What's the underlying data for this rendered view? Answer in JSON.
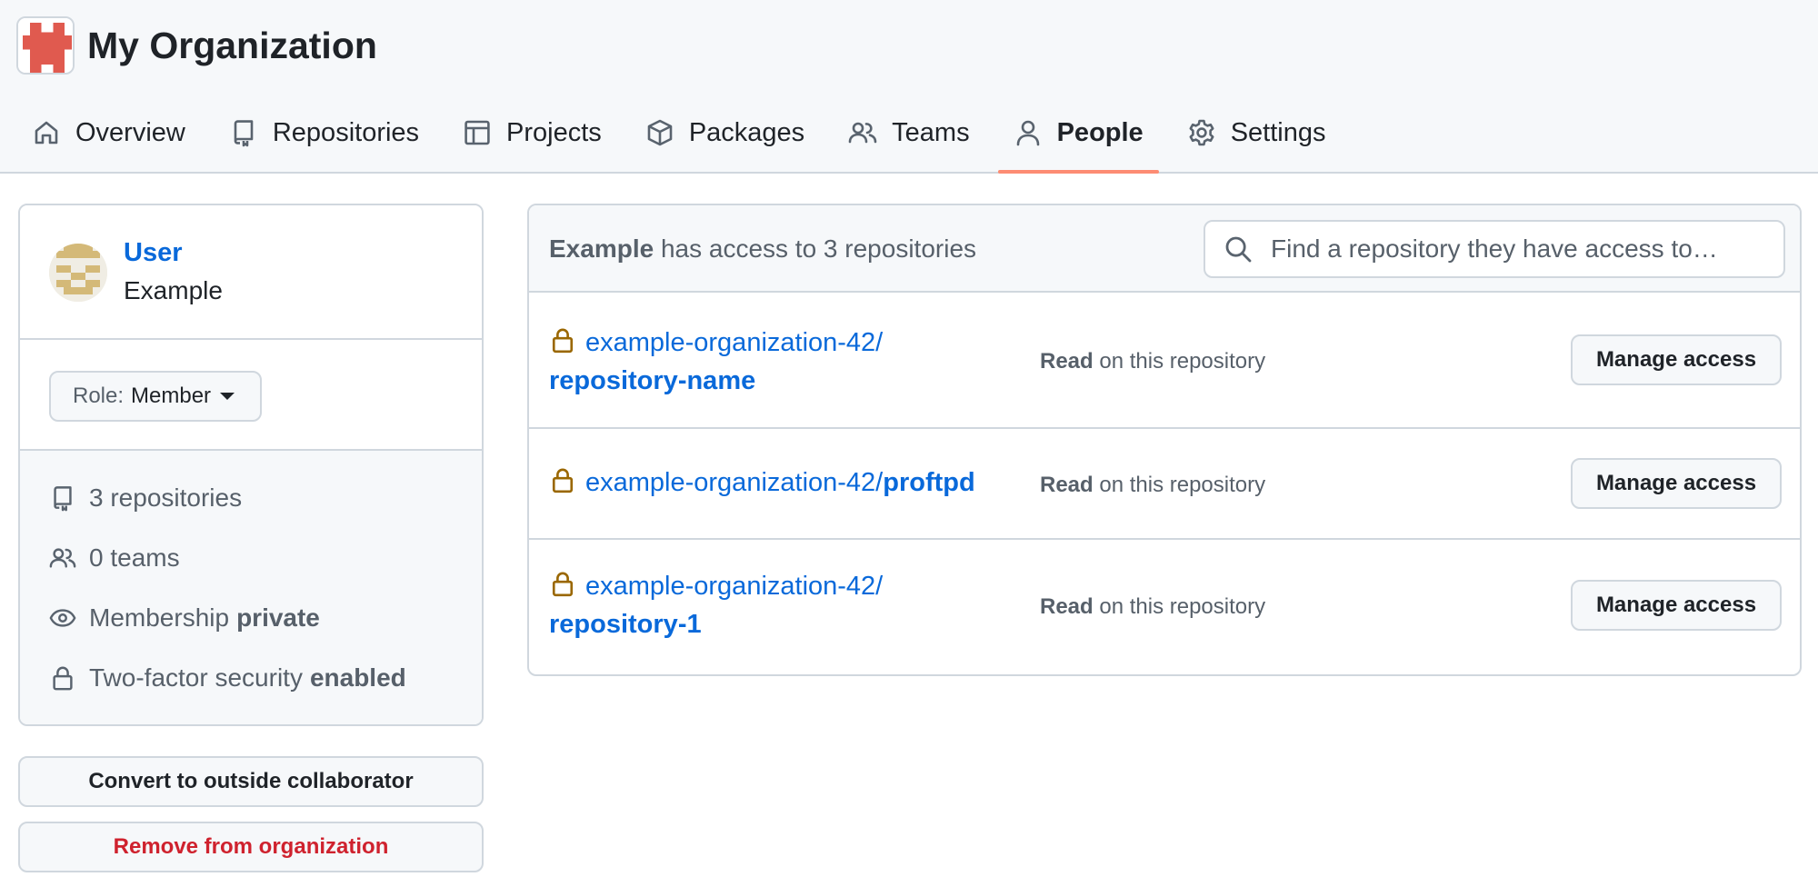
{
  "org": {
    "name": "My Organization",
    "avatar_icon": "org-logo-identicon",
    "avatar_color": "#e05a4f"
  },
  "tabs": [
    {
      "label": "Overview",
      "icon": "home-icon",
      "active": false
    },
    {
      "label": "Repositories",
      "icon": "repo-icon",
      "active": false
    },
    {
      "label": "Projects",
      "icon": "table-icon",
      "active": false
    },
    {
      "label": "Packages",
      "icon": "package-icon",
      "active": false
    },
    {
      "label": "Teams",
      "icon": "people-icon",
      "active": false
    },
    {
      "label": "People",
      "icon": "person-icon",
      "active": true
    },
    {
      "label": "Settings",
      "icon": "gear-icon",
      "active": false
    }
  ],
  "user": {
    "login": "User",
    "full_name": "Example",
    "role_prefix": "Role:",
    "role": "Member",
    "stats": {
      "repos": "3 repositories",
      "teams": "0 teams",
      "membership_prefix": "Membership",
      "membership_value": "private",
      "twofa_prefix": "Two-factor security",
      "twofa_value": "enabled"
    },
    "convert_label": "Convert to outside collaborator",
    "remove_label": "Remove from organization"
  },
  "repo_access": {
    "user_name": "Example",
    "summary": "has access to 3 repositories",
    "search_placeholder": "Find a repository they have access to…",
    "permission_suffix": "on this repository",
    "manage_label": "Manage access",
    "rows": [
      {
        "owner": "example-organization-42/",
        "name": "repository-name",
        "permission": "Read"
      },
      {
        "owner": "example-organization-42/",
        "name": "proftpd",
        "permission": "Read"
      },
      {
        "owner": "example-organization-42/",
        "name": "repository-1",
        "permission": "Read"
      }
    ]
  },
  "colors": {
    "link": "#0969da",
    "danger": "#cf222e",
    "active_tab_underline": "#fd8c73",
    "lock": "#9a6700"
  }
}
